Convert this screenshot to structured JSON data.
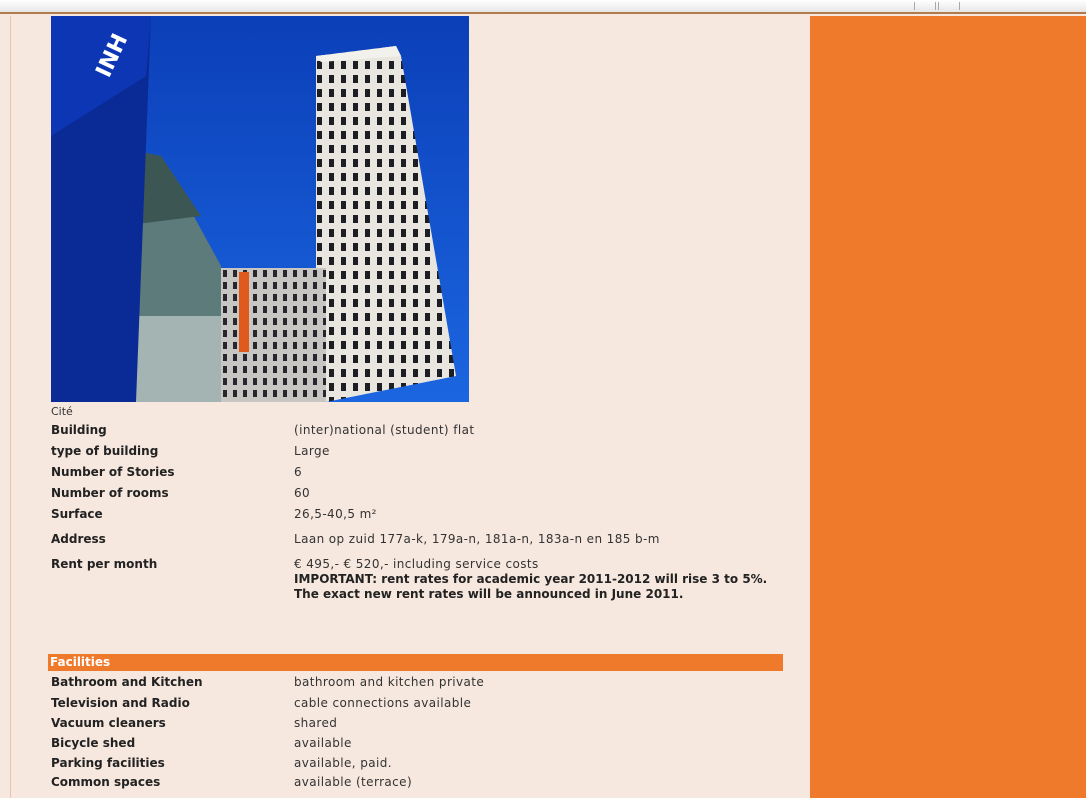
{
  "photo": {
    "alt": "Cité building photo",
    "caption": "Cité",
    "logo_text": "INH"
  },
  "building": [
    {
      "label": "Building",
      "value": "(inter)national (student) flat"
    },
    {
      "label": "type of building",
      "value": "Large"
    },
    {
      "label": "Number of Stories",
      "value": "6"
    },
    {
      "label": "Number of rooms",
      "value": "60"
    },
    {
      "label": "Surface",
      "value": "26,5-40,5 m²"
    },
    {
      "label": "Address",
      "value": "Laan op zuid 177a-k, 179a-n, 181a-n, 183a-n en 185 b-m"
    },
    {
      "label": "Rent per month",
      "value": "€ 495,- € 520,- including service costs",
      "note": "IMPORTANT: rent rates for academic year 2011-2012 will rise 3 to 5%. The exact new rent rates will be announced in June 2011."
    }
  ],
  "facilities": {
    "header": "Facilities",
    "items": [
      {
        "label": "Bathroom and Kitchen",
        "value": "bathroom and kitchen private"
      },
      {
        "label": "Television and Radio",
        "value": "cable connections available"
      },
      {
        "label": "Vacuum cleaners",
        "value": "shared"
      },
      {
        "label": "Bicycle shed",
        "value": "available"
      },
      {
        "label": "Parking facilities",
        "value": "available, paid."
      },
      {
        "label": "Common spaces",
        "value": "available (terrace)"
      }
    ]
  },
  "colors": {
    "accent": "#ef7a2c",
    "background": "#f7e8df"
  }
}
